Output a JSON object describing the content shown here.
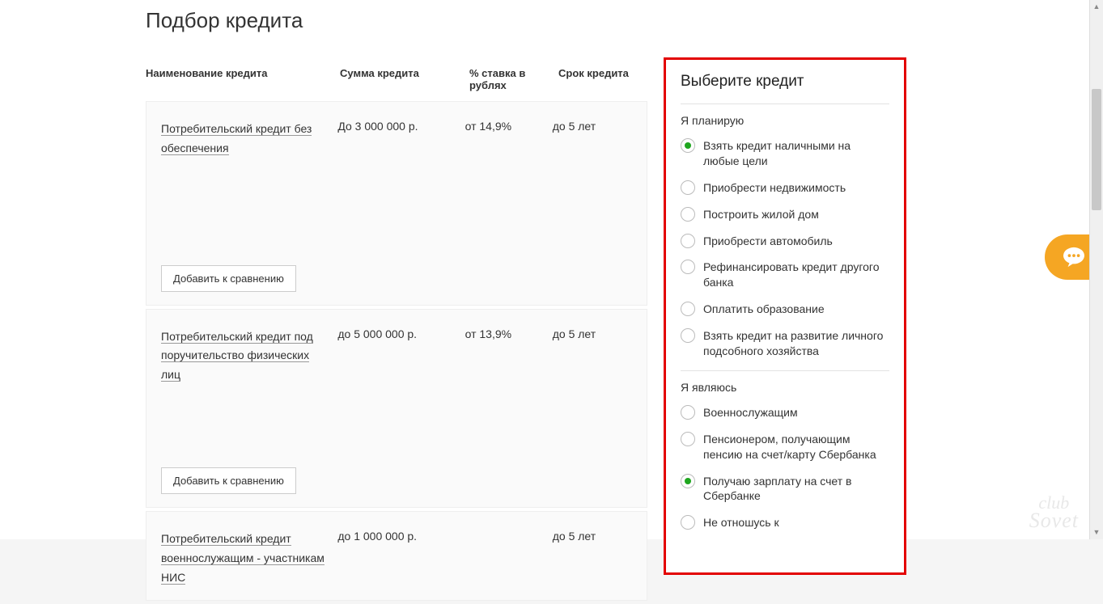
{
  "page": {
    "title": "Подбор кредита"
  },
  "table": {
    "headers": {
      "name": "Наименование кредита",
      "sum": "Сумма кредита",
      "rate": "% ставка в рублях",
      "term": "Срок кредита"
    },
    "credits": [
      {
        "name": "Потребительский кредит без обеспечения",
        "sum": "До 3 000 000 р.",
        "rate": "от 14,9%",
        "term": "до 5 лет",
        "compare": "Добавить к сравнению"
      },
      {
        "name": "Потребительский кредит под поручительство физических лиц",
        "sum": "до 5 000 000 р.",
        "rate": "от 13,9%",
        "term": "до 5 лет",
        "compare": "Добавить к сравнению"
      },
      {
        "name": "Потребительский кредит военнослужащим - участникам НИС",
        "sum": "до 1 000 000 р.",
        "rate": "",
        "term": "до 5 лет"
      }
    ]
  },
  "sidebar": {
    "title": "Выберите кредит",
    "group1_label": "Я планирую",
    "group1": [
      {
        "label": "Взять кредит наличными на любые цели",
        "selected": true
      },
      {
        "label": "Приобрести недвижимость",
        "selected": false
      },
      {
        "label": "Построить жилой дом",
        "selected": false
      },
      {
        "label": "Приобрести автомобиль",
        "selected": false
      },
      {
        "label": "Рефинансировать кредит другого банка",
        "selected": false
      },
      {
        "label": "Оплатить образование",
        "selected": false
      },
      {
        "label": "Взять кредит на развитие личного подсобного хозяйства",
        "selected": false
      }
    ],
    "group2_label": "Я являюсь",
    "group2": [
      {
        "label": "Военнослужащим",
        "selected": false
      },
      {
        "label": "Пенсионером, получающим пенсию на счет/карту Сбербанка",
        "selected": false
      },
      {
        "label": "Получаю зарплату на счет в Сбербанке",
        "selected": true
      },
      {
        "label": "Не отношусь к",
        "selected": false
      }
    ]
  },
  "watermark": {
    "line1": "club",
    "line2": "Sovet"
  }
}
